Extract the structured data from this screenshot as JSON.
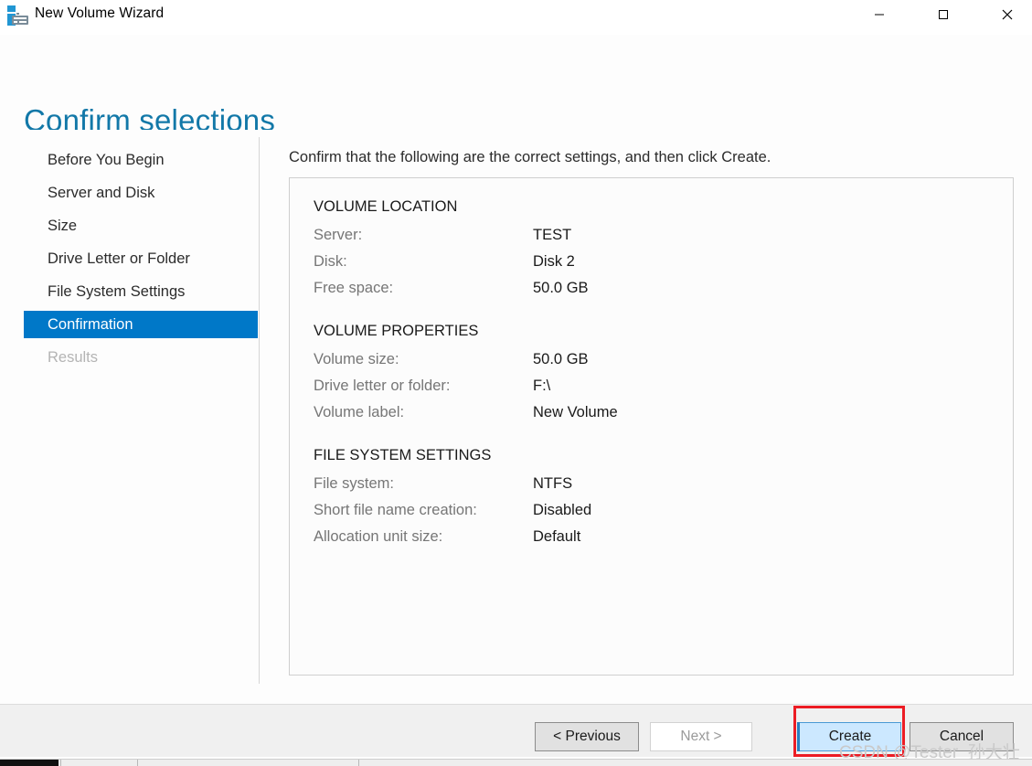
{
  "window": {
    "title": "New Volume Wizard",
    "app_icon": "server-manager-icon",
    "controls": {
      "minimize": "minimize-icon",
      "maximize": "maximize-icon",
      "close": "close-icon"
    }
  },
  "header": {
    "heading": "Confirm selections",
    "heading_color": "#1278a8"
  },
  "sidebar": {
    "selected_color": "#0078c8",
    "items": [
      {
        "label": "Before You Begin",
        "state": "normal"
      },
      {
        "label": "Server and Disk",
        "state": "normal"
      },
      {
        "label": "Size",
        "state": "normal"
      },
      {
        "label": "Drive Letter or Folder",
        "state": "normal"
      },
      {
        "label": "File System Settings",
        "state": "normal"
      },
      {
        "label": "Confirmation",
        "state": "selected"
      },
      {
        "label": "Results",
        "state": "disabled"
      }
    ]
  },
  "content": {
    "instruction": "Confirm that the following are the correct settings, and then click Create.",
    "groups": [
      {
        "title": "VOLUME LOCATION",
        "rows": [
          {
            "label": "Server:",
            "value": "TEST"
          },
          {
            "label": "Disk:",
            "value": "Disk 2"
          },
          {
            "label": "Free space:",
            "value": "50.0 GB"
          }
        ]
      },
      {
        "title": "VOLUME PROPERTIES",
        "rows": [
          {
            "label": "Volume size:",
            "value": "50.0 GB"
          },
          {
            "label": "Drive letter or folder:",
            "value": "F:\\"
          },
          {
            "label": "Volume label:",
            "value": "New Volume"
          }
        ]
      },
      {
        "title": "FILE SYSTEM SETTINGS",
        "rows": [
          {
            "label": "File system:",
            "value": "NTFS"
          },
          {
            "label": "Short file name creation:",
            "value": "Disabled"
          },
          {
            "label": "Allocation unit size:",
            "value": "Default"
          }
        ]
      }
    ]
  },
  "footer": {
    "previous_label": "< Previous",
    "next_label": "Next >",
    "create_label": "Create",
    "cancel_label": "Cancel",
    "next_disabled": true,
    "create_highlight_color": "#ec1c24",
    "create_fill_color": "#cce8ff"
  },
  "watermark": {
    "text": "CSDN @Tester_孙大壮"
  }
}
